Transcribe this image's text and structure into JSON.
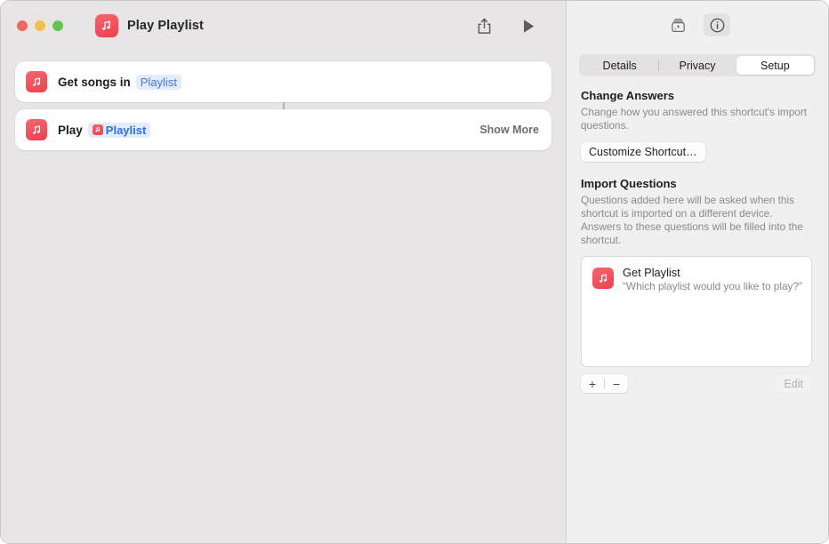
{
  "window": {
    "title": "Play Playlist",
    "app_icon": "music-app-icon",
    "traffic_lights": [
      {
        "name": "close",
        "color": "#ec6a5f"
      },
      {
        "name": "minimize",
        "color": "#f4bd4f"
      },
      {
        "name": "maximize",
        "color": "#61c554"
      }
    ]
  },
  "toolbar": {
    "share_icon": "share-icon",
    "play_icon": "play-icon",
    "action_library_icon": "action-library-icon",
    "info_icon": "info-icon"
  },
  "tabs": [
    {
      "label": "Details",
      "active": false
    },
    {
      "label": "Privacy",
      "active": false
    },
    {
      "label": "Setup",
      "active": true
    }
  ],
  "actions": [
    {
      "icon": "music-app-icon",
      "label": "Get songs in",
      "token": "Playlist",
      "token_has_icon": false,
      "show_more": null
    },
    {
      "icon": "music-app-icon",
      "label": "Play",
      "token": "Playlist",
      "token_has_icon": true,
      "show_more": "Show More"
    }
  ],
  "change_answers": {
    "title": "Change Answers",
    "description": "Change how you answered this shortcut's import questions.",
    "button": "Customize Shortcut…"
  },
  "import_questions": {
    "title": "Import Questions",
    "description": "Questions added here will be asked when this shortcut is imported on a different device. Answers to these questions will be filled into the shortcut.",
    "items": [
      {
        "icon": "music-app-icon",
        "title": "Get Playlist",
        "prompt": "“Which playlist would you like to play?”"
      }
    ],
    "add_button": "+",
    "remove_button": "−",
    "edit_button": "Edit"
  },
  "colors": {
    "accent_red": "#e8424f",
    "token_blue": "#3e79f0",
    "token_bg": "#e3ecfb",
    "left_pane_bg": "#e7e5e6",
    "right_pane_bg": "#f1f0f0"
  }
}
